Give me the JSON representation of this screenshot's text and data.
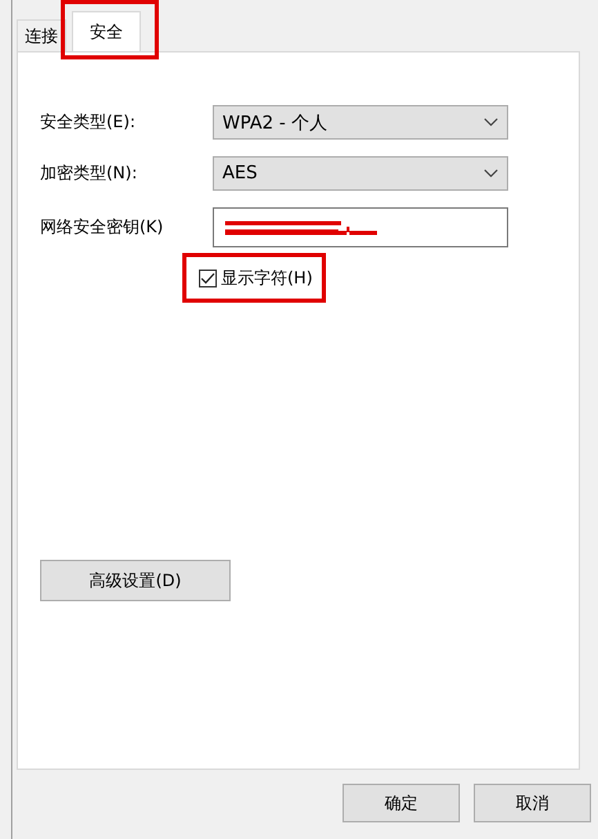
{
  "tabs": [
    {
      "label": "连接",
      "selected": false,
      "highlighted": false
    },
    {
      "label": "安全",
      "selected": true,
      "highlighted": true
    }
  ],
  "fields": [
    {
      "kind": "dropdown",
      "label": "安全类型(E):",
      "value": "WPA2 - 个人"
    },
    {
      "kind": "dropdown",
      "label": "加密类型(N):",
      "value": "AES"
    },
    {
      "kind": "password",
      "label": "网络安全密钥(K)",
      "redacted": true
    }
  ],
  "show_characters": {
    "label": "显示字符(H)",
    "checked": true,
    "highlighted": true
  },
  "advanced_button": "高级设置(D)",
  "buttons": [
    "确定",
    "取消"
  ]
}
